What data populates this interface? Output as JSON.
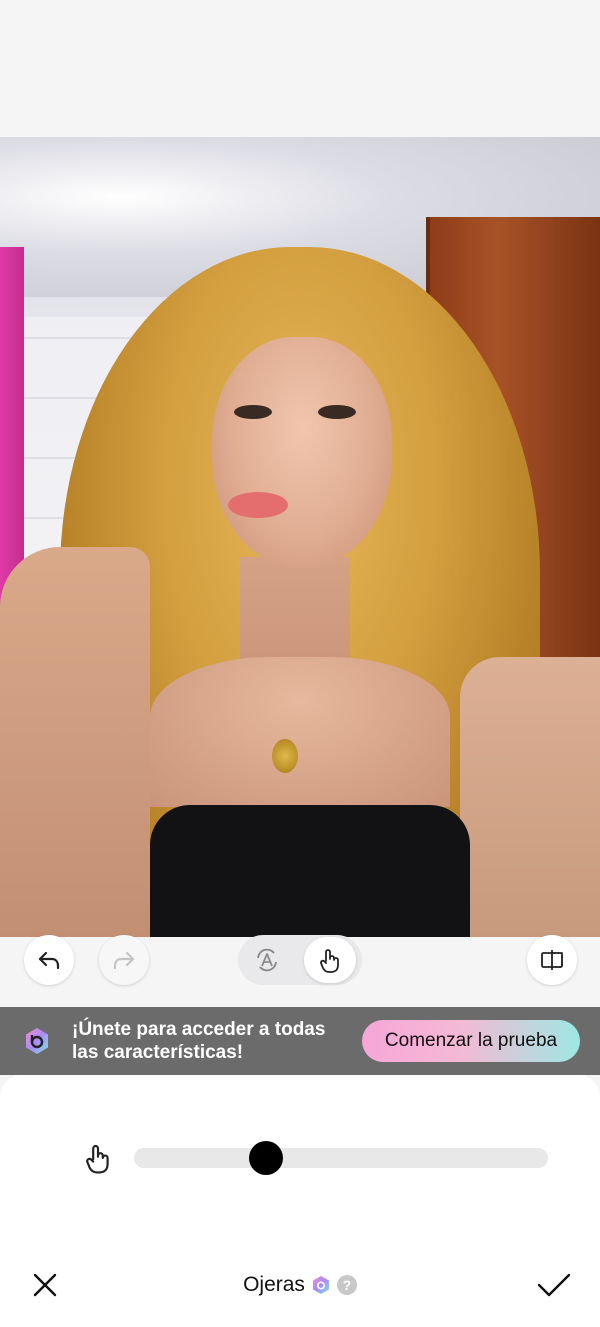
{
  "toolbar": {
    "undo_icon": "undo-icon",
    "redo_icon": "redo-icon",
    "auto_mode_icon": "auto-mode-icon",
    "manual_mode_icon": "hand-touch-icon",
    "compare_icon": "compare-split-icon"
  },
  "promo": {
    "text": "¡Únete para acceder a todas las características!",
    "button_label": "Comenzar la prueba",
    "logo_icon": "premium-logo-icon"
  },
  "slider": {
    "value": 0.32,
    "icon": "hand-touch-icon"
  },
  "feature": {
    "label": "Ojeras",
    "help": "?",
    "gem_icon": "premium-gem-icon"
  },
  "actions": {
    "close_icon": "close-icon",
    "confirm_icon": "check-icon"
  },
  "colors": {
    "background": "#f5f5f5",
    "promo_bg": "#6b6b6b",
    "thumb": "#000000",
    "track": "#e8e8e8"
  }
}
